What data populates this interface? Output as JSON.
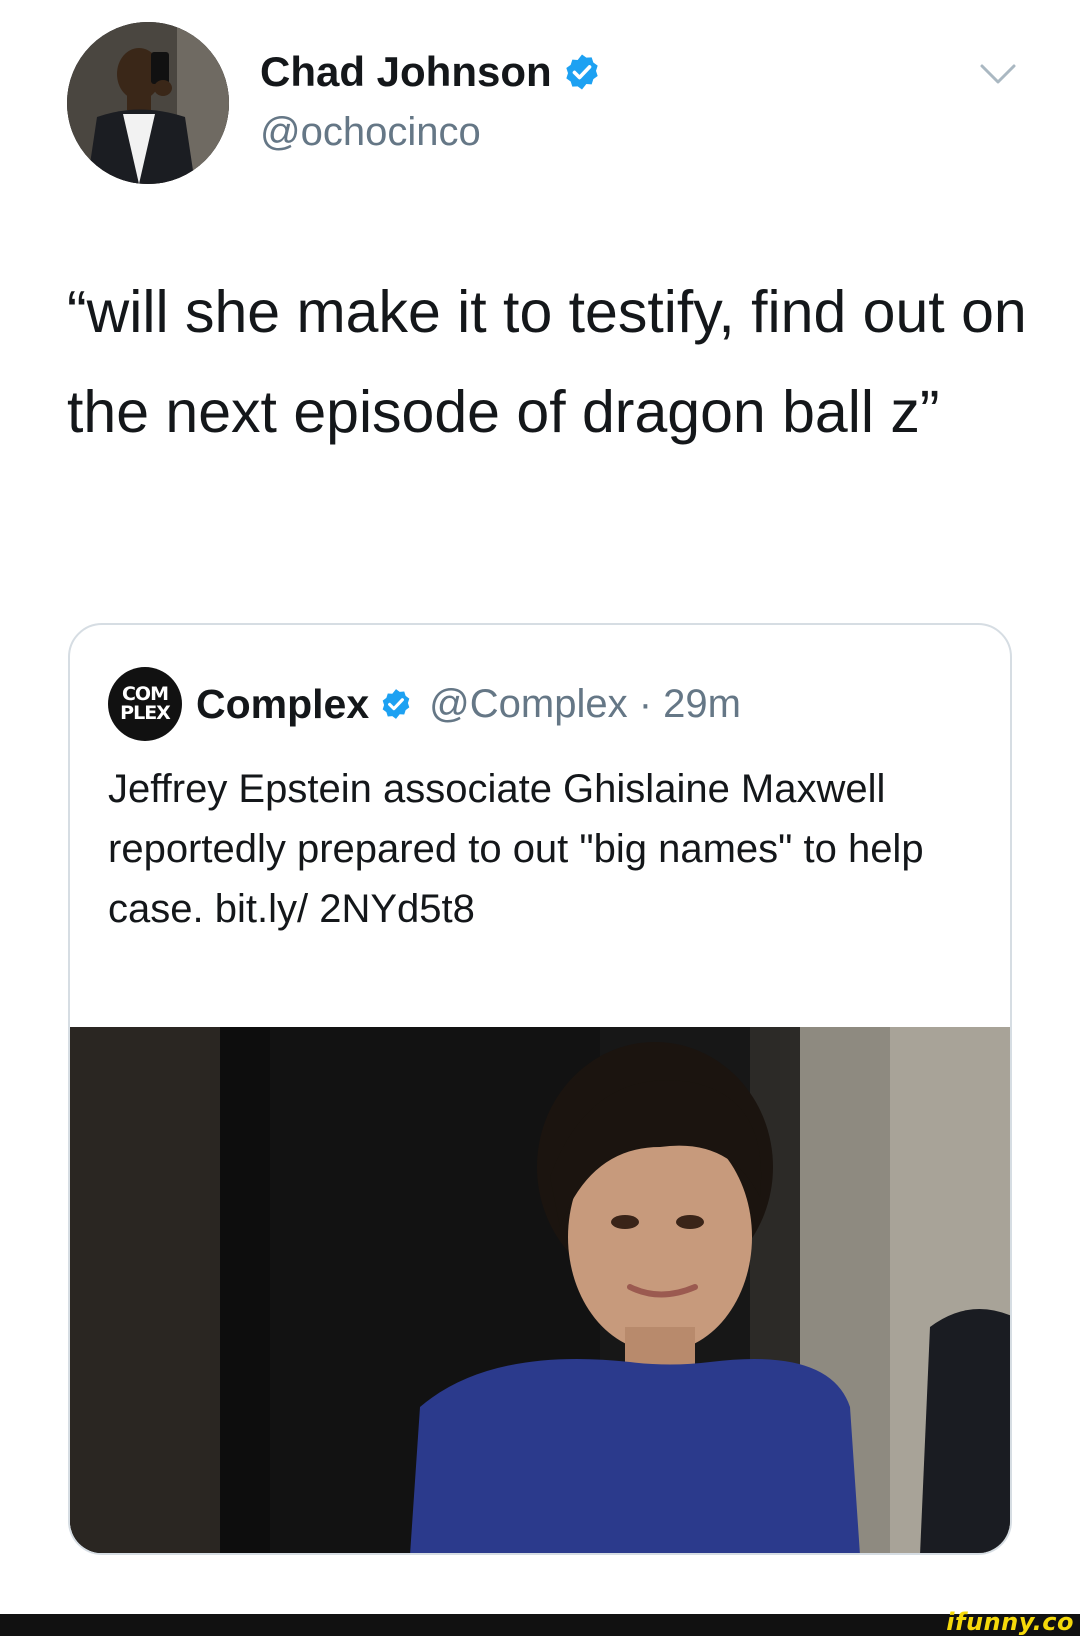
{
  "tweet": {
    "author_name": "Chad Johnson",
    "author_handle": "@ochocinco",
    "text": "“will she make it to testify, find out on the next episode of dragon ball z”",
    "icons": {
      "avatar": "profile-photo",
      "verified": "verified-badge-icon",
      "menu": "chevron-down-icon"
    }
  },
  "quote": {
    "logo_line1": "COM",
    "logo_line2": "PLEX",
    "author_name": "Complex",
    "author_handle_time": "@Complex · 29m",
    "text": "Jeffrey Epstein associate Ghislaine Maxwell reportedly prepared to out \"big names\" to help case. bit.ly/ 2NYd5t8",
    "image": "news-photo"
  },
  "watermark": "ifunny.co",
  "colors": {
    "text_primary": "#14171a",
    "text_secondary": "#657786",
    "verified_blue": "#1da1f2",
    "card_border": "#d6dde3",
    "watermark_yellow": "#f5d90a",
    "footer_bg": "#111111"
  }
}
